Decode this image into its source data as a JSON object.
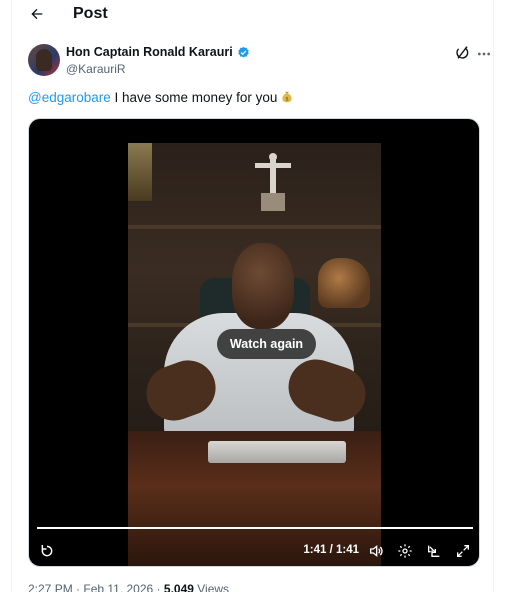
{
  "header": {
    "title": "Post"
  },
  "author": {
    "name": "Hon Captain Ronald Karauri",
    "handle": "@KarauriR"
  },
  "tweet": {
    "mention": "@edgarobare",
    "text": " I have some money for you"
  },
  "media": {
    "watch_again_label": "Watch again",
    "time": "1:41 / 1:41",
    "progress": 1.0
  },
  "meta": {
    "time": "2:27 PM",
    "sep1": " · ",
    "date": "Feb 11, 2026",
    "sep2": " · ",
    "views_count": "5,049",
    "views_label": " Views"
  },
  "colors": {
    "accent": "#1d9bf0",
    "text": "#0f1419",
    "muted": "#536471"
  }
}
